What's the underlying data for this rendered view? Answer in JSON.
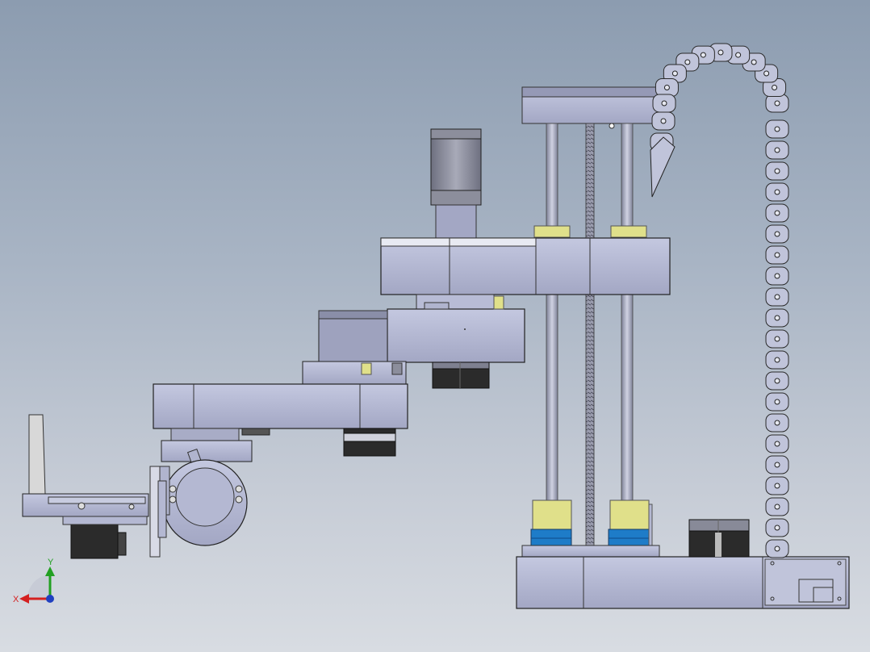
{
  "viewport": {
    "triad": {
      "y_label": "Y",
      "x_label": "X"
    }
  },
  "colors": {
    "metal": "#b4b8d2",
    "metal_dark": "#8e92ae",
    "bushing": "#e0e08a",
    "coupler": "#1e7cc8",
    "motor_dark": "#2b2b2b",
    "axis_x": "#d42020",
    "axis_y": "#22a022"
  }
}
